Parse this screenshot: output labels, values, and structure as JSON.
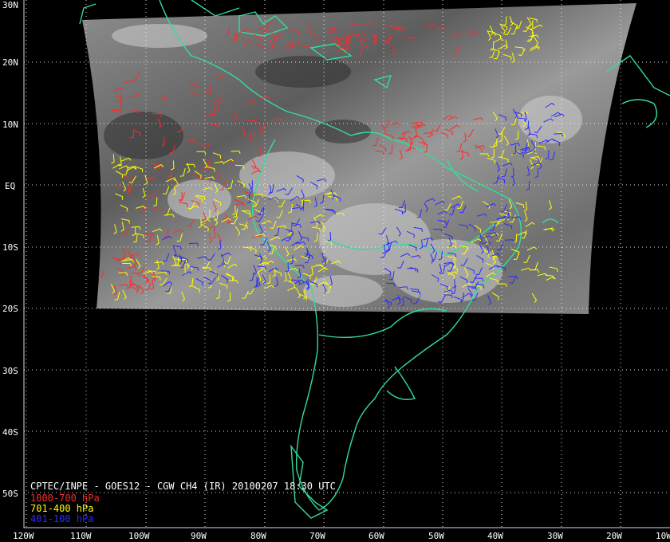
{
  "product": {
    "caption": "CPTEC/INPE - GOES12 - CGW CH4 (IR) 20100207 18:30 UTC"
  },
  "legend": [
    {
      "label": "1000-700 hPa",
      "color": "#ff2a2a"
    },
    {
      "label": "701-400 hPa",
      "color": "#ffff00"
    },
    {
      "label": "401-100 hPa",
      "color": "#2a2aff"
    }
  ],
  "grid": {
    "lat_labels": [
      "30N",
      "20N",
      "10N",
      "EQ",
      "10S",
      "20S",
      "30S",
      "40S",
      "50S"
    ],
    "lon_labels": [
      "120W",
      "110W",
      "100W",
      "90W",
      "80W",
      "70W",
      "60W",
      "50W",
      "40W",
      "30W",
      "20W",
      "10W"
    ]
  },
  "colors": {
    "background": "#000000",
    "coastline": "#33dd99",
    "grid": "#ffffff",
    "imagery": "#7a7a7a"
  }
}
